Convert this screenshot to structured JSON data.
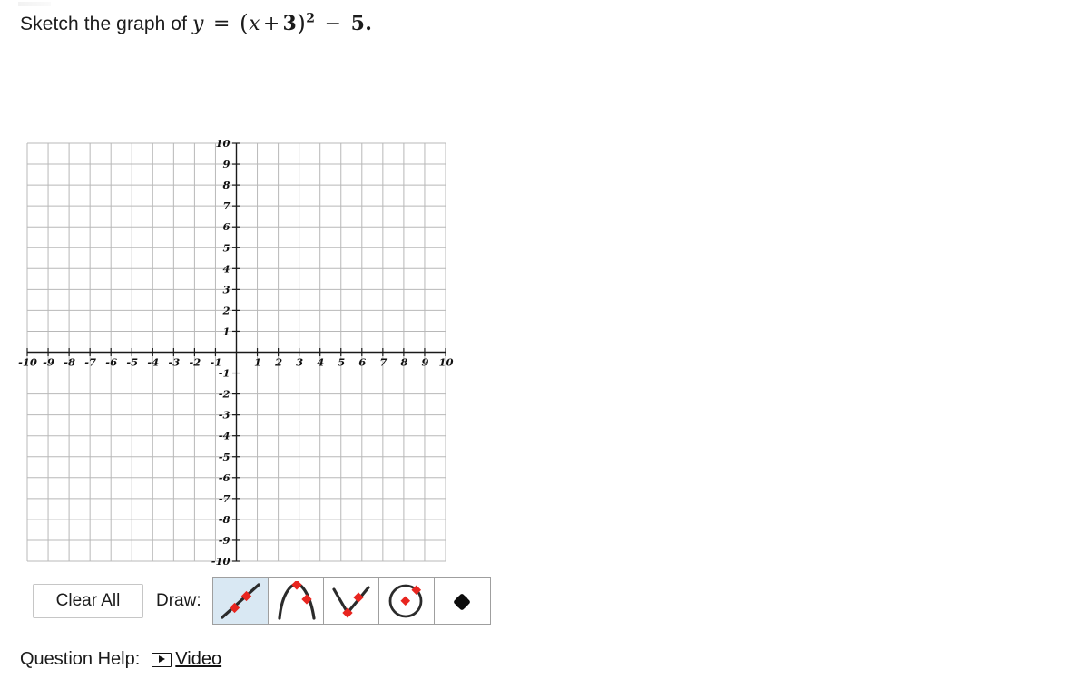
{
  "prompt": {
    "lead": "Sketch the graph of",
    "equation_plain": "y = (x + 3)^2 - 5.",
    "lhs": "y",
    "equals": "=",
    "open_paren": "(",
    "var": "x",
    "plus": "+",
    "inner_constant": "3",
    "close_paren": ")",
    "exponent": "2",
    "minus": "−",
    "outer_constant": "5",
    "period": "."
  },
  "graph": {
    "x_min": -10,
    "x_max": 10,
    "y_min": -10,
    "y_max": 10,
    "x_tick_labels": [
      "-10",
      "-9",
      "-8",
      "-7",
      "-6",
      "-5",
      "-4",
      "-3",
      "-2",
      "-1",
      "1",
      "2",
      "3",
      "4",
      "5",
      "6",
      "7",
      "8",
      "9",
      "10"
    ],
    "y_tick_labels": [
      "10",
      "9",
      "8",
      "7",
      "6",
      "5",
      "4",
      "3",
      "2",
      "1",
      "-1",
      "-2",
      "-3",
      "-4",
      "-5",
      "-6",
      "-7",
      "-8",
      "-9",
      "-10"
    ],
    "grid": "on",
    "grid_color": "#b8b8b8",
    "axis_color": "#1a1a1a",
    "plotted_curve": "none"
  },
  "toolbar": {
    "clear_all_label": "Clear All",
    "draw_label": "Draw:",
    "selected_tool": "line",
    "tools": [
      {
        "id": "line",
        "name": "line-tool",
        "selected": true
      },
      {
        "id": "parabola-down",
        "name": "parabola-down-tool",
        "selected": false
      },
      {
        "id": "parabola-up",
        "name": "parabola-up-tool",
        "selected": false
      },
      {
        "id": "circle",
        "name": "circle-tool",
        "selected": false
      },
      {
        "id": "dot",
        "name": "dot-tool",
        "selected": false
      }
    ],
    "point_color": "#e8251f",
    "stroke_color": "#2b2b2b",
    "selected_bg": "#d9e8f3"
  },
  "help": {
    "label": "Question Help:",
    "video_link_text": "Video",
    "video_icon": "play-icon"
  }
}
